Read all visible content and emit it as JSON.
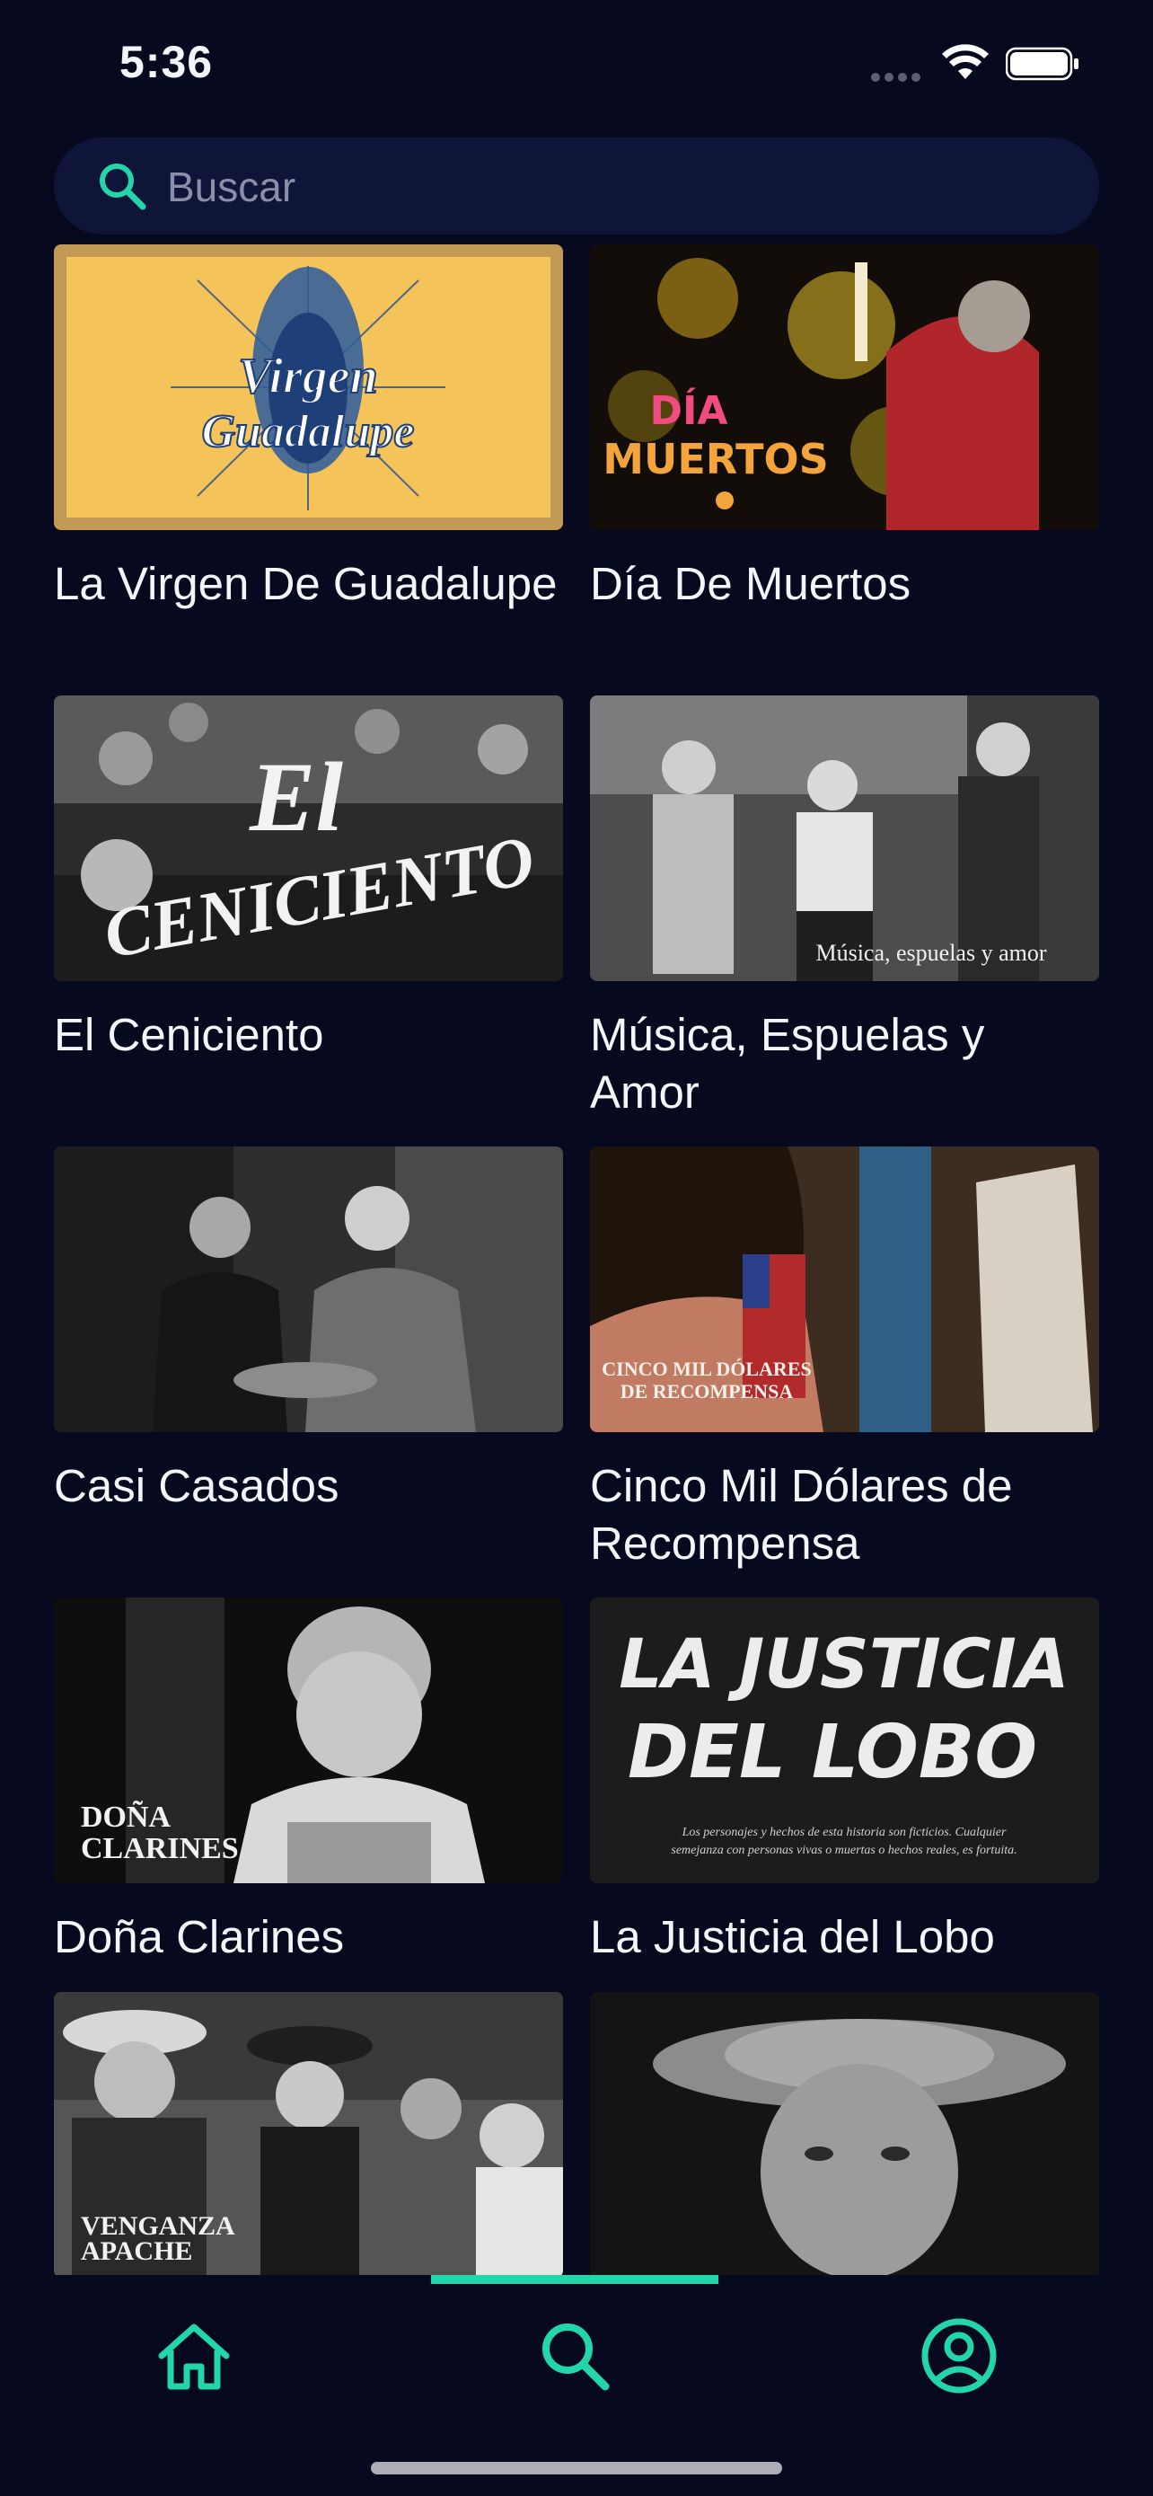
{
  "status_bar": {
    "time": "5:36"
  },
  "search": {
    "placeholder": "Buscar",
    "value": ""
  },
  "results": [
    {
      "title": "La Virgen De Guadalupe",
      "poster_text": "Virgen de Guadalupe"
    },
    {
      "title": "Día De Muertos",
      "poster_text": "DÍA DE MUERTOS"
    },
    {
      "title": "El Ceniciento",
      "poster_text": "EL CENICIENTO"
    },
    {
      "title": "Música, Espuelas y Amor",
      "poster_text": "Música, espuelas y amor"
    },
    {
      "title": "Casi Casados",
      "poster_text": ""
    },
    {
      "title": "Cinco Mil Dólares de Recompensa",
      "poster_text": "CINCO MIL DÓLARES DE RECOMPENSA"
    },
    {
      "title": "Doña Clarines",
      "poster_text": "DOÑA CLARINES"
    },
    {
      "title": "La Justicia del Lobo",
      "poster_text": "LA JUSTICIA DEL LOBO",
      "poster_subtext": "Los personajes y hechos de esta historia son ficticios. Cualquier semejanza con personas vivas o muertas o hechos reales, es fortuita."
    },
    {
      "title": "",
      "poster_text": "VENGANZA APACHE"
    },
    {
      "title": "",
      "poster_text": ""
    }
  ],
  "nav": {
    "tabs": [
      {
        "icon": "home-icon",
        "active": false
      },
      {
        "icon": "search-icon",
        "active": true
      },
      {
        "icon": "profile-icon",
        "active": false
      }
    ]
  },
  "colors": {
    "background": "#070a1f",
    "accent": "#22d6aa",
    "search_bg": "#0f1439"
  }
}
